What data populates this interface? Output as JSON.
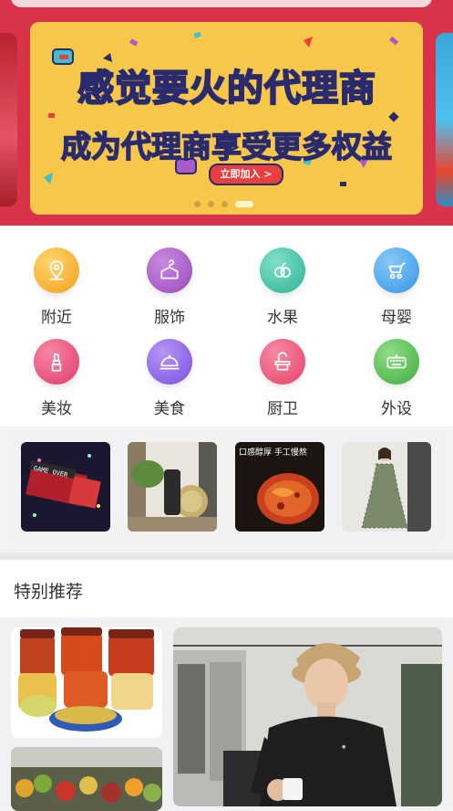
{
  "banner": {
    "line1": "感觉要火的代理商",
    "line2": "成为代理商享受更多权益",
    "button": "立即加入 >",
    "page_count": 4,
    "active_page": 4
  },
  "categories": [
    {
      "label": "附近",
      "icon": "location-pin-icon",
      "color": "#f6b52a"
    },
    {
      "label": "服饰",
      "icon": "shirt-hanger-icon",
      "color": "#a85bc7"
    },
    {
      "label": "水果",
      "icon": "fruit-icon",
      "color": "#3cc3a8"
    },
    {
      "label": "母婴",
      "icon": "stroller-icon",
      "color": "#4aa8f0"
    },
    {
      "label": "美妆",
      "icon": "lipstick-icon",
      "color": "#ef4f79"
    },
    {
      "label": "美食",
      "icon": "food-dome-icon",
      "color": "#8e63e8"
    },
    {
      "label": "厨卫",
      "icon": "faucet-icon",
      "color": "#f0557a"
    },
    {
      "label": "外设",
      "icon": "keyboard-icon",
      "color": "#5bc05a"
    }
  ],
  "thumbnails": [
    {
      "name": "game-box-thumb",
      "caption": "GAME OVER"
    },
    {
      "name": "cafe-thumb",
      "caption": ""
    },
    {
      "name": "hotpot-thumb",
      "caption": "口感醇厚 手工慢熬"
    },
    {
      "name": "dress-thumb",
      "caption": ""
    }
  ],
  "recommend": {
    "title": "特别推荐"
  }
}
